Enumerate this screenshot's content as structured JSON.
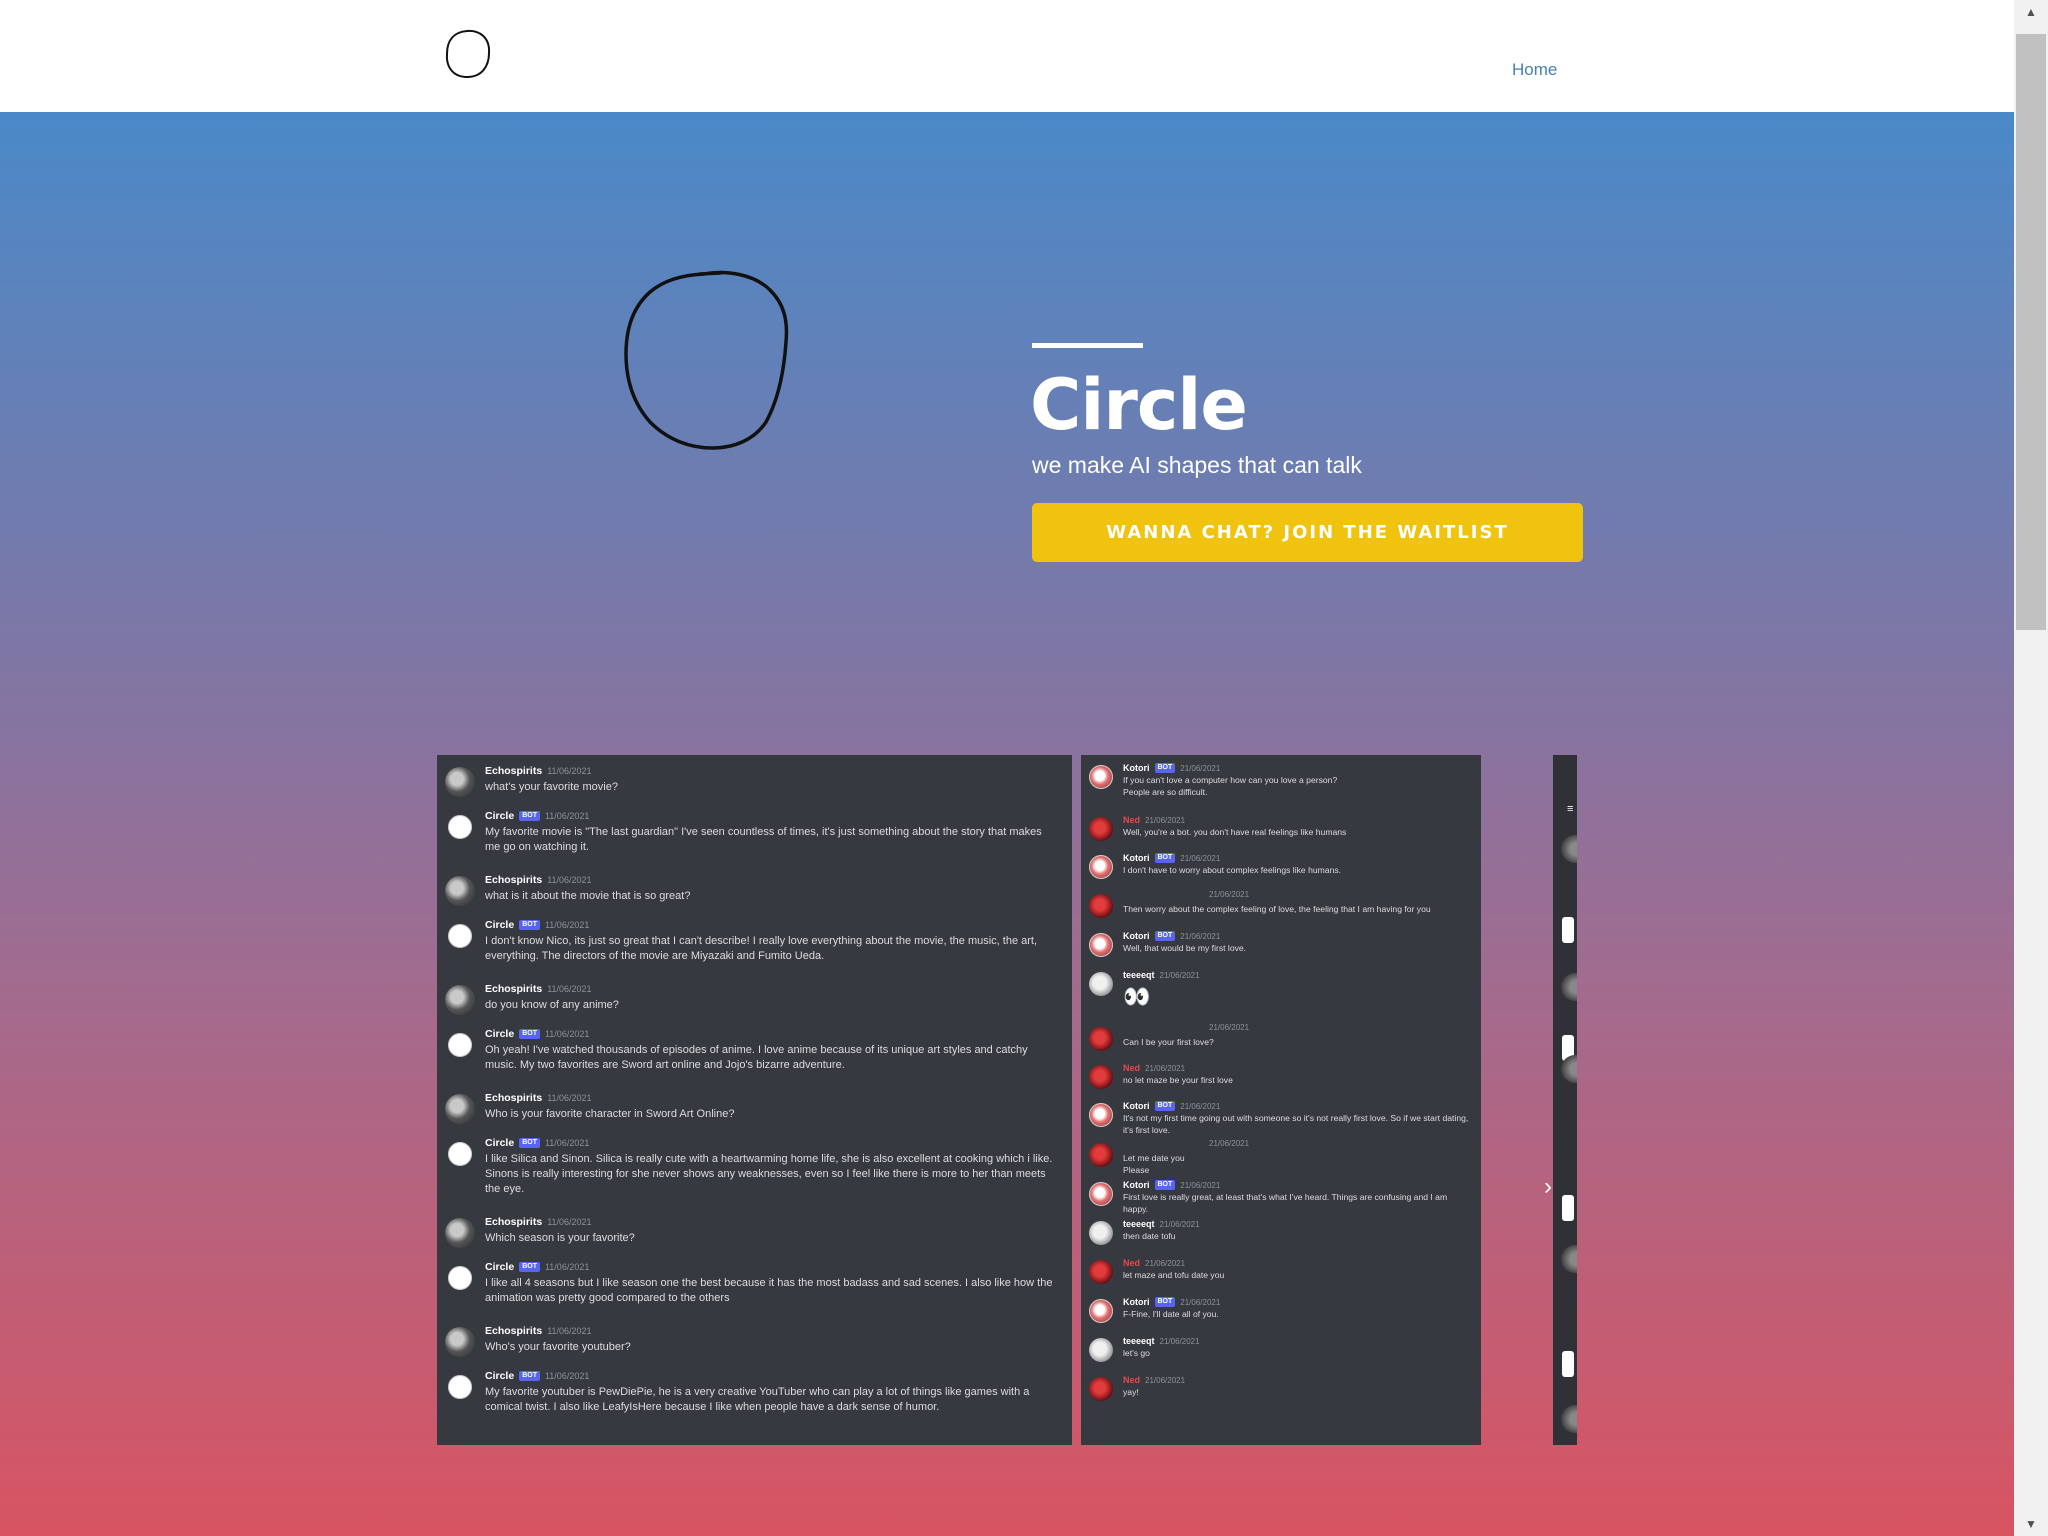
{
  "nav": {
    "home_label": "Home"
  },
  "hero": {
    "title": "Circle",
    "subtitle": "we make AI shapes that can talk",
    "cta_label": "WANNA CHAT? JOIN THE WAITLIST"
  },
  "colors": {
    "cta": "#f0c30f",
    "gradient_top": "#4a89c8",
    "gradient_bottom": "#d85462",
    "chat_bg": "#36393f",
    "nav_link": "#4a7fb5"
  },
  "chat_left": {
    "bot_badge": "BOT",
    "messages": [
      {
        "author": "Echospirits",
        "time": "11/06/2021",
        "bot": false,
        "text": "what's your favorite movie?"
      },
      {
        "author": "Circle",
        "time": "11/06/2021",
        "bot": true,
        "text": "My favorite movie is \"The last guardian\" I've seen countless of times, it's just something about the story that makes me go on watching it."
      },
      {
        "author": "Echospirits",
        "time": "11/06/2021",
        "bot": false,
        "text": "what is it about the movie that is so great?"
      },
      {
        "author": "Circle",
        "time": "11/06/2021",
        "bot": true,
        "text": "I don't know Nico, its just so great that I can't describe! I really love everything about the movie, the music, the art, everything. The directors of the movie are Miyazaki and Fumito Ueda."
      },
      {
        "author": "Echospirits",
        "time": "11/06/2021",
        "bot": false,
        "text": "do you know of any anime?"
      },
      {
        "author": "Circle",
        "time": "11/06/2021",
        "bot": true,
        "text": "Oh yeah! I've watched thousands of episodes of anime. I love anime because of its unique art styles and catchy music. My two favorites are Sword art online and Jojo's bizarre adventure."
      },
      {
        "author": "Echospirits",
        "time": "11/06/2021",
        "bot": false,
        "text": "Who is your favorite character in Sword Art Online?"
      },
      {
        "author": "Circle",
        "time": "11/06/2021",
        "bot": true,
        "text": "I like Silica and Sinon. Silica is really cute with a heartwarming home life, she is also excellent at cooking which i like. Sinons is really interesting for she never shows any weaknesses, even so I feel like there is more to her than meets the eye."
      },
      {
        "author": "Echospirits",
        "time": "11/06/2021",
        "bot": false,
        "text": "Which season is your favorite?"
      },
      {
        "author": "Circle",
        "time": "11/06/2021",
        "bot": true,
        "text": "I like all 4 seasons but I like season one the best because it has the most badass and sad scenes. I also like how the animation was pretty good compared to the others"
      },
      {
        "author": "Echospirits",
        "time": "11/06/2021",
        "bot": false,
        "text": "Who's your favorite youtuber?"
      },
      {
        "author": "Circle",
        "time": "11/06/2021",
        "bot": true,
        "text": "My favorite youtuber is PewDiePie, he is a very creative YouTuber who can play a lot of things like games with a comical twist. I also like LeafyIsHere because I like when people have a dark sense of humor."
      }
    ]
  },
  "chat_mid": {
    "bot_badge": "BOT",
    "messages": [
      {
        "author": "Kotori",
        "time": "21/06/2021",
        "bot": true,
        "lines": [
          "If you can't love a computer how can you love a person?",
          "People are so difficult."
        ]
      },
      {
        "author": "Ned",
        "time": "21/06/2021",
        "bot": false,
        "lines": [
          "Well, you're a bot. you don't have real feelings like humans"
        ]
      },
      {
        "author": "Kotori",
        "time": "21/06/2021",
        "bot": true,
        "lines": [
          "I don't have to worry about complex feelings like humans."
        ]
      },
      {
        "author": "",
        "time": "21/06/2021",
        "bot": false,
        "lines": [
          "Then worry about the complex feeling of love, the feeling that I am having for you"
        ]
      },
      {
        "author": "Kotori",
        "time": "21/06/2021",
        "bot": true,
        "lines": [
          "Well, that would be my first love."
        ]
      },
      {
        "author": "teeeeqt",
        "time": "21/06/2021",
        "bot": false,
        "lines": [
          "👀"
        ]
      },
      {
        "author": "",
        "time": "21/06/2021",
        "bot": false,
        "lines": [
          "Can I be your first love?"
        ]
      },
      {
        "author": "Ned",
        "time": "21/06/2021",
        "bot": false,
        "lines": [
          "no let maze be your first love"
        ]
      },
      {
        "author": "Kotori",
        "time": "21/06/2021",
        "bot": true,
        "lines": [
          "It's not my first time going out with someone so it's not really first love. So if we start dating, it's first love."
        ]
      },
      {
        "author": "",
        "time": "21/06/2021",
        "bot": false,
        "lines": [
          "Let me date you",
          "Please"
        ]
      },
      {
        "author": "Kotori",
        "time": "21/06/2021",
        "bot": true,
        "lines": [
          "First love is really great, at least that's what I've heard. Things are confusing and I am happy."
        ]
      },
      {
        "author": "teeeeqt",
        "time": "21/06/2021",
        "bot": false,
        "lines": [
          "then date tofu"
        ]
      },
      {
        "author": "Ned",
        "time": "21/06/2021",
        "bot": false,
        "lines": [
          "let maze and tofu date you"
        ]
      },
      {
        "author": "Kotori",
        "time": "21/06/2021",
        "bot": true,
        "lines": [
          "F-Fine, I'll date all of you."
        ]
      },
      {
        "author": "teeeeqt",
        "time": "21/06/2021",
        "bot": false,
        "lines": [
          "let's go"
        ]
      },
      {
        "author": "Ned",
        "time": "21/06/2021",
        "bot": false,
        "lines": [
          "yay!"
        ]
      }
    ]
  },
  "icons": {
    "logo": "circle-logo",
    "next": "chevron-right-icon",
    "scroll_up": "arrow-up-icon",
    "scroll_down": "arrow-down-icon"
  }
}
